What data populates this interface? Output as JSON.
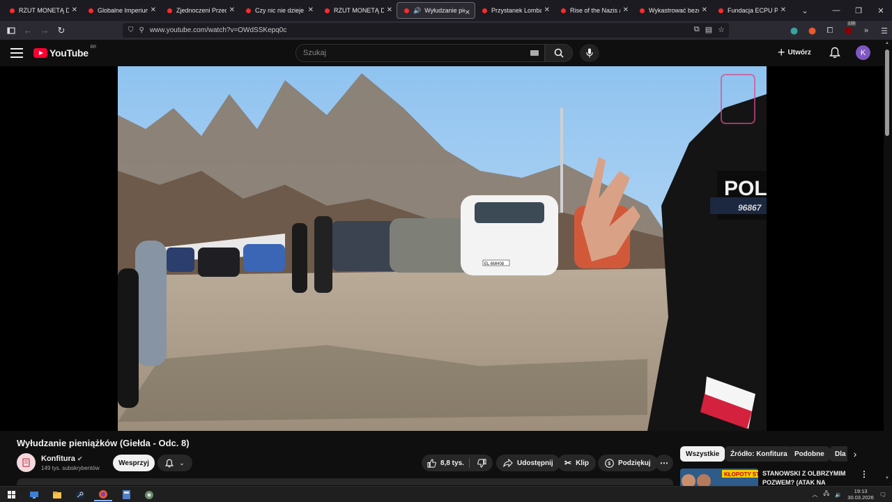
{
  "browser": {
    "tabs": [
      {
        "title": "RZUT MONETĄ DECYDU",
        "active": false
      },
      {
        "title": "Globalne Imperium BlackR",
        "active": false
      },
      {
        "title": "Zjednoczeni Przeciw",
        "active": false
      },
      {
        "title": "Czy nic nie dzieje się",
        "active": false
      },
      {
        "title": "RZUT MONETĄ DECYDU",
        "active": false
      },
      {
        "title": "Wyłudzanie pieniążków",
        "active": true
      },
      {
        "title": "Przystanek Lombard",
        "active": false
      },
      {
        "title": "Rise of the Nazis and",
        "active": false
      },
      {
        "title": "Wykastrować bezdomnego",
        "active": false
      },
      {
        "title": "Fundacja ECPU Polska",
        "active": false
      }
    ],
    "url": "www.youtube.com/watch?v=OWdSSKepq0c",
    "extension_badge": "139"
  },
  "youtube": {
    "logo_text": "YouTube",
    "country_code": "BR",
    "search_placeholder": "Szukaj",
    "create_label": "Utwórz",
    "avatar_letter": "K"
  },
  "video": {
    "title": "Wyłudzanie pieniążków (Giełda - Odc. 8)",
    "channel_name": "Konfitura",
    "subscribers": "149 tys. subskrybentów",
    "support_label": "Wesprzyj",
    "likes": "8,8 tys.",
    "share_label": "Udostępnij",
    "clip_label": "Klip",
    "thanks_label": "Podziękuj",
    "scene": {
      "police_text": "POLI",
      "badge_number": "96867",
      "plate_1": "EL 6MH08"
    }
  },
  "chips": [
    "Wszystkie",
    "Źródło: Konfitura",
    "Podobne",
    "Dla Ciebie"
  ],
  "recommended": {
    "title": "STANOWSKI Z OLBRZYMIM POZWEM? (ATAK NA",
    "thumb_text": "KŁOPOTY STANOWSKIEGO"
  },
  "taskbar": {
    "time": "19:13",
    "date": "30.03.2026"
  },
  "colors": {
    "yt_red": "#ff0033",
    "background": "#0f0f0f",
    "avatar": "#7e57c2"
  }
}
